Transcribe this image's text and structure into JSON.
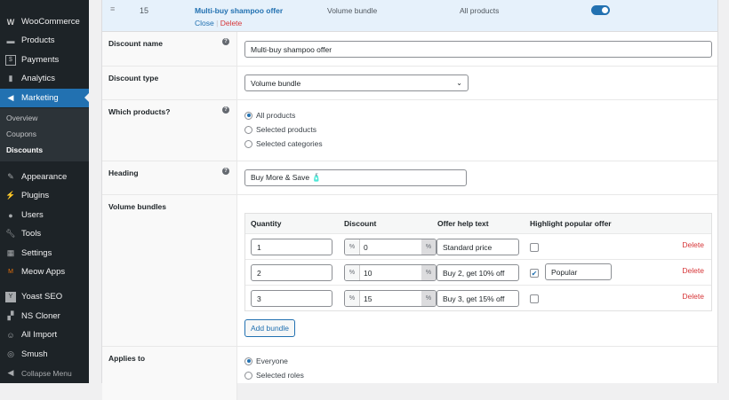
{
  "sidebar": {
    "items": [
      {
        "label": "WooCommerce",
        "icon": "woo-icon"
      },
      {
        "label": "Products",
        "icon": "archive-icon"
      },
      {
        "label": "Payments",
        "icon": "dollar-icon"
      },
      {
        "label": "Analytics",
        "icon": "bar-chart-icon"
      },
      {
        "label": "Marketing",
        "icon": "megaphone-icon"
      },
      {
        "label": "Appearance",
        "icon": "brush-icon"
      },
      {
        "label": "Plugins",
        "icon": "plug-icon"
      },
      {
        "label": "Users",
        "icon": "user-icon"
      },
      {
        "label": "Tools",
        "icon": "wrench-icon"
      },
      {
        "label": "Settings",
        "icon": "sliders-icon"
      },
      {
        "label": "Meow Apps",
        "icon": "meow-icon"
      },
      {
        "label": "Yoast SEO",
        "icon": "yoast-icon"
      },
      {
        "label": "NS Cloner",
        "icon": "cloner-icon"
      },
      {
        "label": "All Import",
        "icon": "import-icon"
      },
      {
        "label": "Smush",
        "icon": "smush-icon"
      },
      {
        "label": "Collapse Menu",
        "icon": "collapse-icon"
      }
    ],
    "submenu": [
      "Overview",
      "Coupons",
      "Discounts"
    ]
  },
  "header": {
    "id": "15",
    "name": "Multi-buy shampoo offer",
    "close": "Close",
    "sep": "|",
    "delete": "Delete",
    "type": "Volume bundle",
    "products": "All products",
    "enabled": true
  },
  "form": {
    "name_label": "Discount name",
    "name_value": "Multi-buy shampoo offer",
    "type_label": "Discount type",
    "type_value": "Volume bundle",
    "products_label": "Which products?",
    "products_options": [
      "All products",
      "Selected products",
      "Selected categories"
    ],
    "heading_label": "Heading",
    "heading_value": "Buy More & Save 🧴",
    "bundles_label": "Volume bundles",
    "columns": [
      "Quantity",
      "Discount",
      "Offer help text",
      "Highlight popular offer"
    ],
    "bundles": [
      {
        "qty": "1",
        "discount": "0",
        "help": "Standard price",
        "popular": false,
        "popular_text": ""
      },
      {
        "qty": "2",
        "discount": "10",
        "help": "Buy 2, get 10% off",
        "popular": true,
        "popular_text": "Popular"
      },
      {
        "qty": "3",
        "discount": "15",
        "help": "Buy 3, get 15% off",
        "popular": false,
        "popular_text": ""
      }
    ],
    "percent": "%",
    "delete": "Delete",
    "add_bundle": "Add bundle",
    "applies_label": "Applies to",
    "applies_options": [
      "Everyone",
      "Selected roles"
    ]
  },
  "help_icon": "?"
}
